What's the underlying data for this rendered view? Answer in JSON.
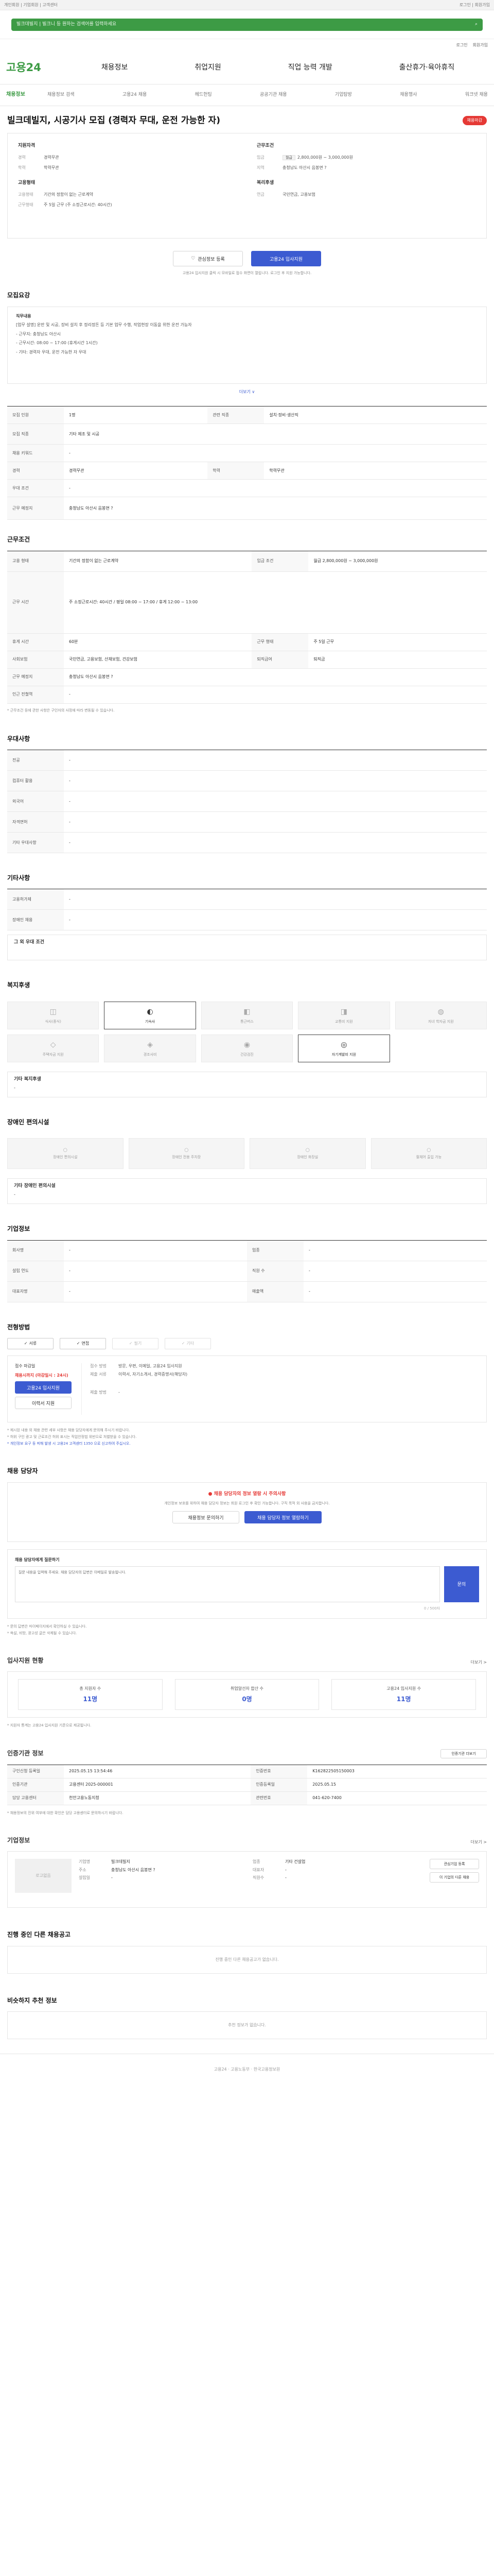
{
  "topbar": {
    "left": "개인회원 | 기업회원 | 고객센터",
    "right": "로그인 | 회원가입"
  },
  "search": {
    "placeholder": "빌크데빌지 | 빌크니 등 원하는 검색어를 입력하세요"
  },
  "utils": [
    "로그인",
    "회원가입"
  ],
  "gnb": {
    "logo": "고용24",
    "menu": [
      "채용정보",
      "취업지원",
      "직업 능력 개발",
      "출산휴가·육아휴직"
    ]
  },
  "subnav": {
    "current": "채용정보",
    "items": [
      "채용정보 검색",
      "고용24 채용",
      "헤드헌팅",
      "공공기관 채용",
      "기업탐방",
      "채용행사",
      "워크넷 채용"
    ]
  },
  "job": {
    "title": "빌크데빌지, 시공기사 모집 (경력자 무대, 운전 가능한 자)",
    "badge": "채용마감"
  },
  "summary": {
    "left_title": "지원자격",
    "left": [
      {
        "k": "경력",
        "v": "경력무관"
      },
      {
        "k": "학력",
        "v": "학력무관"
      }
    ],
    "left2_title": "고용형태",
    "left2": [
      {
        "k": "고용형태",
        "v": "기간의 정함이 없는 근로계약"
      },
      {
        "k": "근무형태",
        "v": "주 5일 근무 (주 소정근로시간: 40시간)"
      }
    ],
    "right_title": "근무조건",
    "right": [
      {
        "k": "임금",
        "pay": "월급",
        "v": "2,800,000원 ~ 3,000,000원"
      },
      {
        "k": "지역",
        "v": "충청남도 아산시 음봉면 ?"
      }
    ],
    "right2_title": "복리후생",
    "right2": [
      {
        "k": "연금",
        "v": "국민연금, 고용보험"
      }
    ]
  },
  "cta": {
    "save": "관심정보 등록",
    "apply": "고용24 입사지원",
    "note": "고용24 입사지원 클릭 시 모바일로 접수 화면이 열립니다. 로그인 후 지원 가능합니다."
  },
  "intro": {
    "title": "직무내용",
    "lines": [
      "[업무 설명] 운반 및 시공, 장비 설치 후 정리정돈 등 기본 업무 수행, 작업현장 이동을 위한 운전 가능자",
      "- 근무지: 충청남도 아산시",
      "- 근무시간: 08:00 ~ 17:00 (휴게시간 1시간)",
      "- 기타: 경력자 우대, 운전 가능한 자 우대"
    ],
    "more": "더보기 ∨"
  },
  "detail": [
    {
      "k": "모집 인원",
      "v": "1명"
    },
    {
      "k": "모집 직종",
      "v": "기타 제조 및 시공"
    },
    {
      "k": "관련 직종",
      "v": "설치·정비·생산직"
    },
    {
      "k": "채용 키워드",
      "v": "-"
    },
    {
      "k": "경력",
      "v": "경력무관"
    },
    {
      "k": "학력",
      "v": "학력무관"
    },
    {
      "k": "우대 조건",
      "v": "-"
    },
    {
      "k": "근무 예정지",
      "v": "충청남도 아산시 음봉면 ?"
    }
  ],
  "workcond": [
    {
      "k": "고용 형태",
      "v": "기간의 정함이 없는 근로계약"
    },
    {
      "k": "임금 조건",
      "v": "월급 2,800,000원 ~ 3,000,000원"
    },
    {
      "k": "근무 시간",
      "v": "주 소정근로시간: 40시간 / 평일 08:00 ~ 17:00 / 휴게 12:00 ~ 13:00"
    },
    {
      "k": "휴게 시간",
      "v": "60분"
    },
    {
      "k": "근무 형태",
      "v": "주 5일 근무"
    },
    {
      "k": "사회보험",
      "v": "국민연금, 고용보험, 산재보험, 건강보험"
    },
    {
      "k": "퇴직급여",
      "v": "퇴직금"
    },
    {
      "k": "근무 예정지",
      "v": "충청남도 아산시 음봉면 ?"
    },
    {
      "k": "인근 전철역",
      "v": "-"
    }
  ],
  "workcond_note": "* 근무조건 등에 관한 사항은 구인자의 사정에 따라 변동될 수 있습니다.",
  "extra_title": "우대사항",
  "extra": [
    {
      "k": "전공",
      "v": "-"
    },
    {
      "k": "컴퓨터 활용",
      "v": "-"
    },
    {
      "k": "외국어",
      "v": "-"
    },
    {
      "k": "자격면허",
      "v": "-"
    },
    {
      "k": "기타 우대사항",
      "v": "-"
    }
  ],
  "other_title": "기타사항",
  "other": [
    {
      "k": "고용허가제",
      "v": "-"
    },
    {
      "k": "장애인 채용",
      "v": "-"
    }
  ],
  "other_more": "그 외 우대 조건",
  "welfare_title": "복지후생",
  "welfare": [
    {
      "ic": "◫",
      "t": "식사(중식)",
      "on": false
    },
    {
      "ic": "◐",
      "t": "기숙사",
      "on": true
    },
    {
      "ic": "◧",
      "t": "통근버스",
      "on": false
    },
    {
      "ic": "◨",
      "t": "교통비 지원",
      "on": false
    },
    {
      "ic": "◍",
      "t": "자녀 학자금 지원",
      "on": false
    },
    {
      "ic": "◇",
      "t": "주택자금 지원",
      "on": false
    },
    {
      "ic": "◈",
      "t": "경조사비",
      "on": false
    },
    {
      "ic": "◉",
      "t": "건강검진",
      "on": false
    },
    {
      "ic": "◎",
      "t": "자기계발비 지원",
      "on": true
    }
  ],
  "welfare_etc_title": "기타 복지후생",
  "welfare_etc": "-",
  "disab_title": "장애인 편의시설",
  "disab": [
    {
      "ic": "◯",
      "t": "장애인 편의시설"
    },
    {
      "ic": "◯",
      "t": "장애인 전용 주차장"
    },
    {
      "ic": "◯",
      "t": "장애인 화장실"
    },
    {
      "ic": "◯",
      "t": "휠체어 출입 가능"
    }
  ],
  "disab_etc_title": "기타 장애인 편의시설",
  "disab_etc": "-",
  "company_title": "기업정보",
  "company": [
    {
      "k": "회사명",
      "v": "-"
    },
    {
      "k": "업종",
      "v": "-"
    },
    {
      "k": "설립 연도",
      "v": "-"
    },
    {
      "k": "직원 수",
      "v": "-"
    },
    {
      "k": "대표자명",
      "v": "-"
    },
    {
      "k": "매출액",
      "v": "-"
    }
  ],
  "method_title": "전형방법",
  "methods": [
    {
      "t": "서류",
      "on": true
    },
    {
      "t": "면접",
      "on": true
    },
    {
      "t": "필기",
      "on": false
    },
    {
      "t": "기타",
      "on": false
    }
  ],
  "apply": {
    "label": "접수 마감일",
    "deadline": "채용시까지 (마감일시 : 24시)",
    "btn1": "고용24 입사지원",
    "btn2": "이력서 지원",
    "rows": [
      {
        "k": "접수 방법",
        "v": "방문, 우편, 이메일, 고용24 입사지원"
      },
      {
        "k": "제출 서류",
        "v": "이력서, 자기소개서, 경력증명서(해당자)"
      },
      {
        "k": "제출 방법",
        "v": "-"
      }
    ]
  },
  "apply_notes": [
    "* 제시된 내용 외 채용 관련 세부 사항은 채용 담당자에게 문의해 주시기 바랍니다.",
    "* 허위 구인 광고 및 근로조건 허위 표시는 직업안정법 위반으로 처벌받을 수 있습니다.",
    "* 개인정보 요구 등 피해 발생 시 고용24 고객센터 1350 으로 신고하여 주십시오."
  ],
  "contact_title": "채용 담당자",
  "warn": {
    "t": "채용 담당자의 정보 열람 시 주의사항",
    "p": "개인정보 보호를 위하여 채용 담당자 정보는 회원 로그인 후 확인 가능합니다. 구직 목적 외 사용을 금지합니다.",
    "b1": "채용정보 문의하기",
    "b2": "채용 담당자 정보 열람하기"
  },
  "qa": {
    "label": "채용 담당자에게 질문하기",
    "placeholder": "질문 내용을 입력해 주세요. 채용 담당자의 답변은 이메일로 발송됩니다.",
    "btn": "문의",
    "count": "0 / 500자"
  },
  "qa_notes": [
    "* 문의 답변은 마이페이지에서 확인하실 수 있습니다.",
    "* 욕설, 비방, 광고성 글은 삭제될 수 있습니다."
  ],
  "stats_title": "입사지원 현황",
  "stats_more": "더보기 >",
  "stats": [
    {
      "lb": "총 지원자 수",
      "nm": "11명"
    },
    {
      "lb": "취업알선자 합산 수",
      "nm": "0명"
    },
    {
      "lb": "고용24 입사지원 수",
      "nm": "11명"
    }
  ],
  "stats_note": "* 지원자 통계는 고용24 입사지원 기준으로 제공됩니다.",
  "authinfo_title": "인증기관 정보",
  "authinfo_btn": "인증기관 더보기",
  "authinfo": [
    {
      "k": "구인신청 등록일",
      "v": "2025.05.15 13:54:46"
    },
    {
      "k": "인증번호",
      "v": "K162822505150003"
    },
    {
      "k": "인증기관",
      "v": "고용센터 2025-000001"
    },
    {
      "k": "인증등록일",
      "v": "2025.05.15"
    },
    {
      "k": "담당 고용센터",
      "v": "천안고용노동지청"
    },
    {
      "k": "관련번호",
      "v": "041-620-7400"
    }
  ],
  "authinfo_note": "* 채용정보의 진위 여부에 대한 확인은 담당 고용센터로 문의하시기 바랍니다.",
  "corp_title": "기업정보",
  "corp_more": "더보기 >",
  "corp": {
    "logo": "로고없음",
    "fields": [
      {
        "k": "기업명",
        "v": "빌크데빌지"
      },
      {
        "k": "업종",
        "v": "기타 건설업"
      },
      {
        "k": "주소",
        "v": "충청남도 아산시 음봉면 ?"
      },
      {
        "k": "대표자",
        "v": "-"
      },
      {
        "k": "설립일",
        "v": "-"
      },
      {
        "k": "직원수",
        "v": "-"
      }
    ],
    "b1": "관심기업 등록",
    "b2": "이 기업의 다른 채용"
  },
  "ongoing_title": "진행 중인 다른 채용공고",
  "ongoing_empty": "진행 중인 다른 채용공고가 없습니다.",
  "rec_title": "비슷하지 추천 정보",
  "rec_empty": "추천 정보가 없습니다.",
  "footer": "고용24 · 고용노동부 · 한국고용정보원"
}
